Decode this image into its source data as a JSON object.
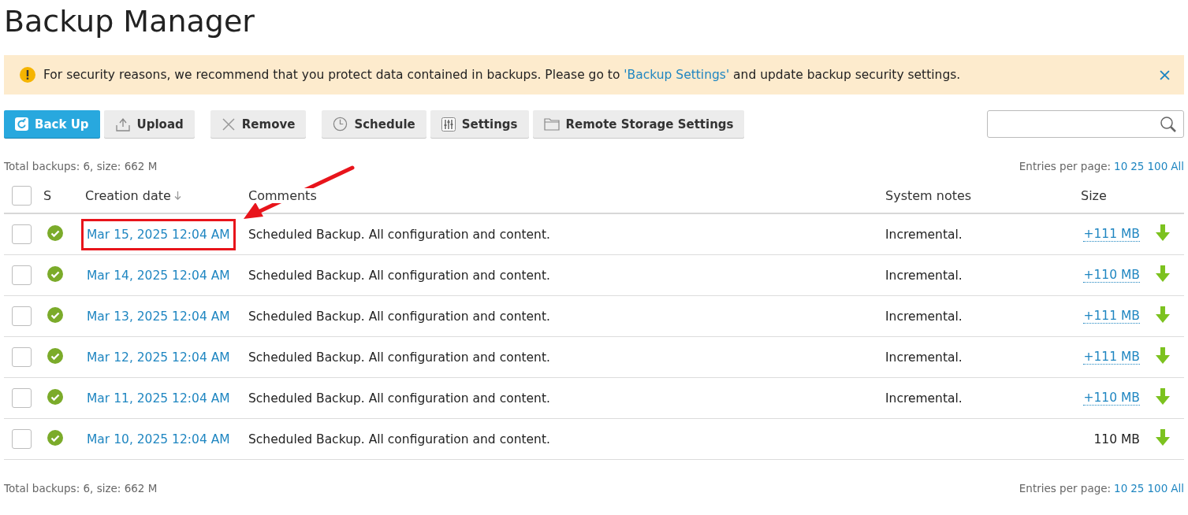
{
  "title": "Backup Manager",
  "alert": {
    "text_before": "For security reasons, we recommend that you protect data contained in backups. Please go to ",
    "link": "'Backup Settings'",
    "text_after": " and update backup security settings."
  },
  "toolbar": [
    {
      "label": "Back Up",
      "kind": "primary"
    },
    {
      "label": "Upload",
      "kind": "default"
    },
    {
      "label": "Remove",
      "kind": "default"
    },
    {
      "label": "Schedule",
      "kind": "default"
    },
    {
      "label": "Settings",
      "kind": "default"
    },
    {
      "label": "Remote Storage Settings",
      "kind": "default"
    }
  ],
  "summary_top": {
    "total": "Total backups: 6, size: 662 M",
    "entries_label": "Entries per page:",
    "entries_options": [
      "10",
      "25",
      "100",
      "All"
    ]
  },
  "table": {
    "select_all_checked": false,
    "columns": [
      {
        "label": "S",
        "sorted": false
      },
      {
        "label": "Creation date",
        "sorted": true
      },
      {
        "label": "Comments",
        "sorted": false
      },
      {
        "label": "System notes",
        "sorted": false
      },
      {
        "label": "Size",
        "sorted": false
      }
    ],
    "rows": [
      {
        "checked": false,
        "success": true,
        "date": "Mar 15, 2025 12:04 AM",
        "highlighted": true,
        "comment": "Scheduled Backup. All configuration and content.",
        "notes": "Incremental.",
        "size": "+111 MB",
        "size_linked": true
      },
      {
        "checked": false,
        "success": true,
        "date": "Mar 14, 2025 12:04 AM",
        "highlighted": false,
        "comment": "Scheduled Backup. All configuration and content.",
        "notes": "Incremental.",
        "size": "+110 MB",
        "size_linked": true
      },
      {
        "checked": false,
        "success": true,
        "date": "Mar 13, 2025 12:04 AM",
        "highlighted": false,
        "comment": "Scheduled Backup. All configuration and content.",
        "notes": "Incremental.",
        "size": "+111 MB",
        "size_linked": true
      },
      {
        "checked": false,
        "success": true,
        "date": "Mar 12, 2025 12:04 AM",
        "highlighted": false,
        "comment": "Scheduled Backup. All configuration and content.",
        "notes": "Incremental.",
        "size": "+111 MB",
        "size_linked": true
      },
      {
        "checked": false,
        "success": true,
        "date": "Mar 11, 2025 12:04 AM",
        "highlighted": false,
        "comment": "Scheduled Backup. All configuration and content.",
        "notes": "Incremental.",
        "size": "+110 MB",
        "size_linked": true
      },
      {
        "checked": false,
        "success": true,
        "date": "Mar 10, 2025 12:04 AM",
        "highlighted": false,
        "comment": "Scheduled Backup. All configuration and content.",
        "size": "110 MB",
        "size_linked": false
      }
    ]
  },
  "summary_bottom": {
    "total": "Total backups: 6, size: 662 M",
    "entries_label": "Entries per page:",
    "entries_options": [
      "10",
      "25",
      "100",
      "All"
    ]
  }
}
